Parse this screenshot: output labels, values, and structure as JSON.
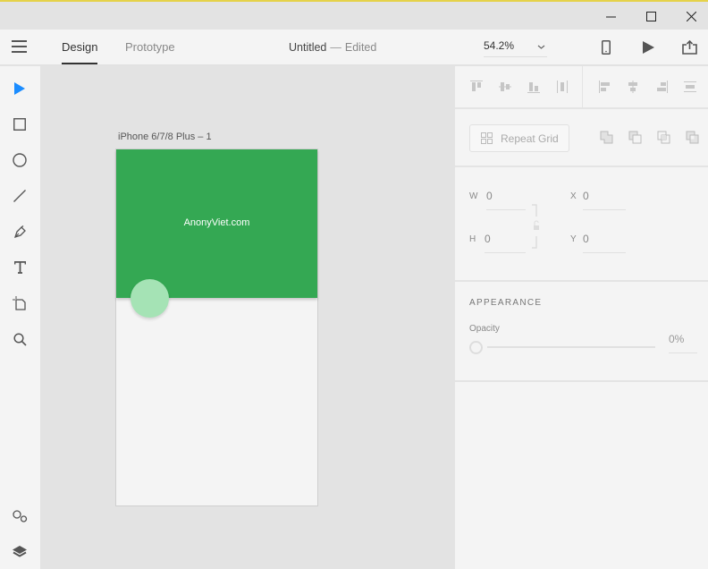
{
  "window": {
    "controls": {
      "minimize": "minimize-icon",
      "maximize": "maximize-icon",
      "close": "close-icon"
    }
  },
  "toolbar": {
    "menu_icon": "hamburger-icon",
    "tabs": [
      {
        "label": "Design",
        "active": true
      },
      {
        "label": "Prototype",
        "active": false
      }
    ],
    "document": {
      "name": "Untitled",
      "separator": "—",
      "status": "Edited"
    },
    "zoom_level": "54.2%",
    "zoom_chevron": "⌄",
    "right_icons": [
      "device-preview-icon",
      "play-icon",
      "share-icon"
    ]
  },
  "tools": [
    "select-icon",
    "rectangle-icon",
    "ellipse-icon",
    "line-icon",
    "pen-icon",
    "text-icon",
    "artboard-icon",
    "zoom-icon",
    "symbols-icon",
    "layers-icon"
  ],
  "canvas": {
    "artboard_label": "iPhone 6/7/8 Plus – 1",
    "header_text": "AnonyViet.com",
    "colors": {
      "header": "#34a853",
      "fab": "#a5e3b5",
      "artboard": "#f4f4f4"
    }
  },
  "properties": {
    "align_icons": [
      "align-top-icon",
      "align-middle-icon",
      "align-bottom-icon",
      "distribute-vertical-icon",
      "align-left-icon",
      "align-center-icon",
      "align-right-icon",
      "distribute-horizontal-icon"
    ],
    "repeat_grid_label": "Repeat Grid",
    "boolean_icons": [
      "add-icon",
      "subtract-icon",
      "intersect-icon",
      "exclude-icon"
    ],
    "fields": {
      "w_label": "W",
      "w_value": "0",
      "h_label": "H",
      "h_value": "0",
      "x_label": "X",
      "x_value": "0",
      "y_label": "Y",
      "y_value": "0"
    },
    "appearance_title": "APPEARANCE",
    "opacity_label": "Opacity",
    "opacity_value": "0%",
    "opacity_fraction": 0
  }
}
